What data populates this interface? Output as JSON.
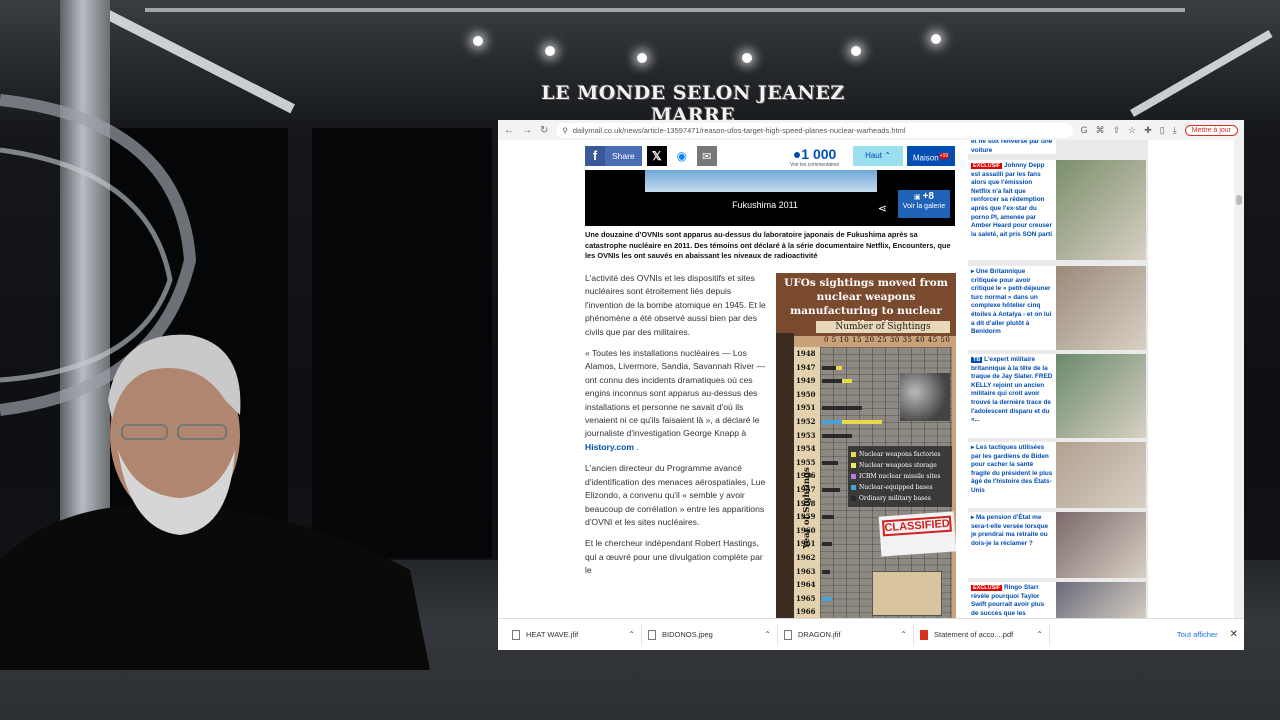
{
  "banner": {
    "title": "LE MONDE SELON JEANEZ MARRE"
  },
  "browser": {
    "url": "dailymail.co.uk/news/article-13597471/reason-ufos-target-high-speed-planes-nuclear-warheads.html",
    "update_label": "Mettre à jour"
  },
  "share": {
    "facebook_label": "Share",
    "count": "1 000",
    "count_sub": "Voir les commentaires",
    "haut_label": "Haut",
    "maison_label": "Maison",
    "maison_badge": "+99"
  },
  "photo": {
    "caption": "Fukushima 2011",
    "gallery_count": "+8",
    "gallery_label": "Voir la galerie"
  },
  "article": {
    "lede": "Une douzaine d'OVNIs sont apparus au-dessus du laboratoire japonais de Fukushima après sa catastrophe nucléaire en 2011. Des témoins ont déclaré à la série documentaire Netflix, Encounters, que les OVNIs les ont sauvés en abaissant les niveaux de radioactivité",
    "p1": "L'activité des OVNIs et les dispositifs et sites nucléaires sont étroitement liés depuis l'invention de la bombe atomique en 1945. Et le phénomène a été observé aussi bien par des civils que par des militaires.",
    "p2": "« Toutes les installations nucléaires — Los Alamos, Livermore, Sandia, Savannah River — ont connu des incidents dramatiques où ces engins inconnus sont apparus au-dessus des installations et personne ne savait d'où ils venaient ni ce qu'ils faisaient là », a déclaré le journaliste d'investigation George Knapp à",
    "p2_link": "History.com",
    "p2_end": ".",
    "p3": "L'ancien directeur du Programme avancé d'identification des menaces aérospatiales, Lue Elizondo, a convenu qu'il « semble y avoir beaucoup de corrélation » entre les apparitions d'OVNI et les sites nucléaires.",
    "p4": "Et le chercheur indépendant Robert Hastings, qui a œuvré pour une divulgation complète par le"
  },
  "infographic": {
    "title": "UFOs sightings moved from nuclear weapons manufacturing to nuclear missile silos",
    "subtitle": "Number of Sightings",
    "axis_ticks": "0 5 10 15 20 25 30 35 40 45 50",
    "ylabel": "Year of Sightings",
    "years": [
      "1948",
      "1947",
      "1949",
      "1950",
      "1951",
      "1952",
      "1953",
      "1954",
      "1955",
      "1956",
      "1957",
      "1958",
      "1959",
      "1960",
      "1961",
      "1962",
      "1963",
      "1964",
      "1965",
      "1966"
    ],
    "legend": [
      {
        "label": "Nuclear weapons factories",
        "color": "#e8d84a"
      },
      {
        "label": "Nuclear weapons storage",
        "color": "#f2ea6a"
      },
      {
        "label": "ICBM nuclear missile sites",
        "color": "#b57be0"
      },
      {
        "label": "Nuclear-equipped bases",
        "color": "#4aa0d8"
      },
      {
        "label": "Ordinary military bases",
        "color": "#2a2a2a"
      }
    ],
    "stamp": "CLASSIFIED"
  },
  "sidebar": [
    {
      "tag": "",
      "text": "et ne soit renversé par une voiture"
    },
    {
      "tag": "EXCLUSIF",
      "text": "Johnny Depp est assailli par les fans alors que l'émission Netflix n'a fait que renforcer sa rédemption après que l'ex-star du porno PI, amenée par Amber Heard pour creuser la saleté, ait pris SON parti"
    },
    {
      "tag": "",
      "text": "Une Britannique critiquée pour avoir critiqué le « petit-déjeuner turc normal » dans un complexe hôtelier cinq étoiles à Antalya - et on lui a dit d'aller plutôt à Benidorm"
    },
    {
      "tag": "TB",
      "text": "L'expert militaire britannique à la tête de la traque de Jay Slater. FRED KELLY rejoint un ancien militaire qui croit avoir trouvé la dernière trace de l'adolescent disparu et du «..."
    },
    {
      "tag": "",
      "text": "Les tactiques utilisées par les gardiens de Biden pour cacher la santé fragile du président le plus âgé de l'histoire des États-Unis"
    },
    {
      "tag": "",
      "text": "Ma pension d'État me sera-t-elle versée lorsque je prendrai ma retraite ou dois-je la réclamer ?"
    },
    {
      "tag": "EXCLUSIF",
      "text": "Ringo Starr révèle pourquoi Taylor Swift pourrait avoir plus de succès que les"
    }
  ],
  "downloads": [
    {
      "name": "HEAT WAVE.jfif",
      "type": "img"
    },
    {
      "name": "BIDONOS.jpeg",
      "type": "img"
    },
    {
      "name": "DRAGON.jfif",
      "type": "img"
    },
    {
      "name": "Statement of acco....pdf",
      "type": "pdf"
    }
  ],
  "downloads_show_all": "Tout afficher",
  "colors": {
    "dailymail_blue": "#004db3",
    "exclusive_red": "#e60000"
  }
}
